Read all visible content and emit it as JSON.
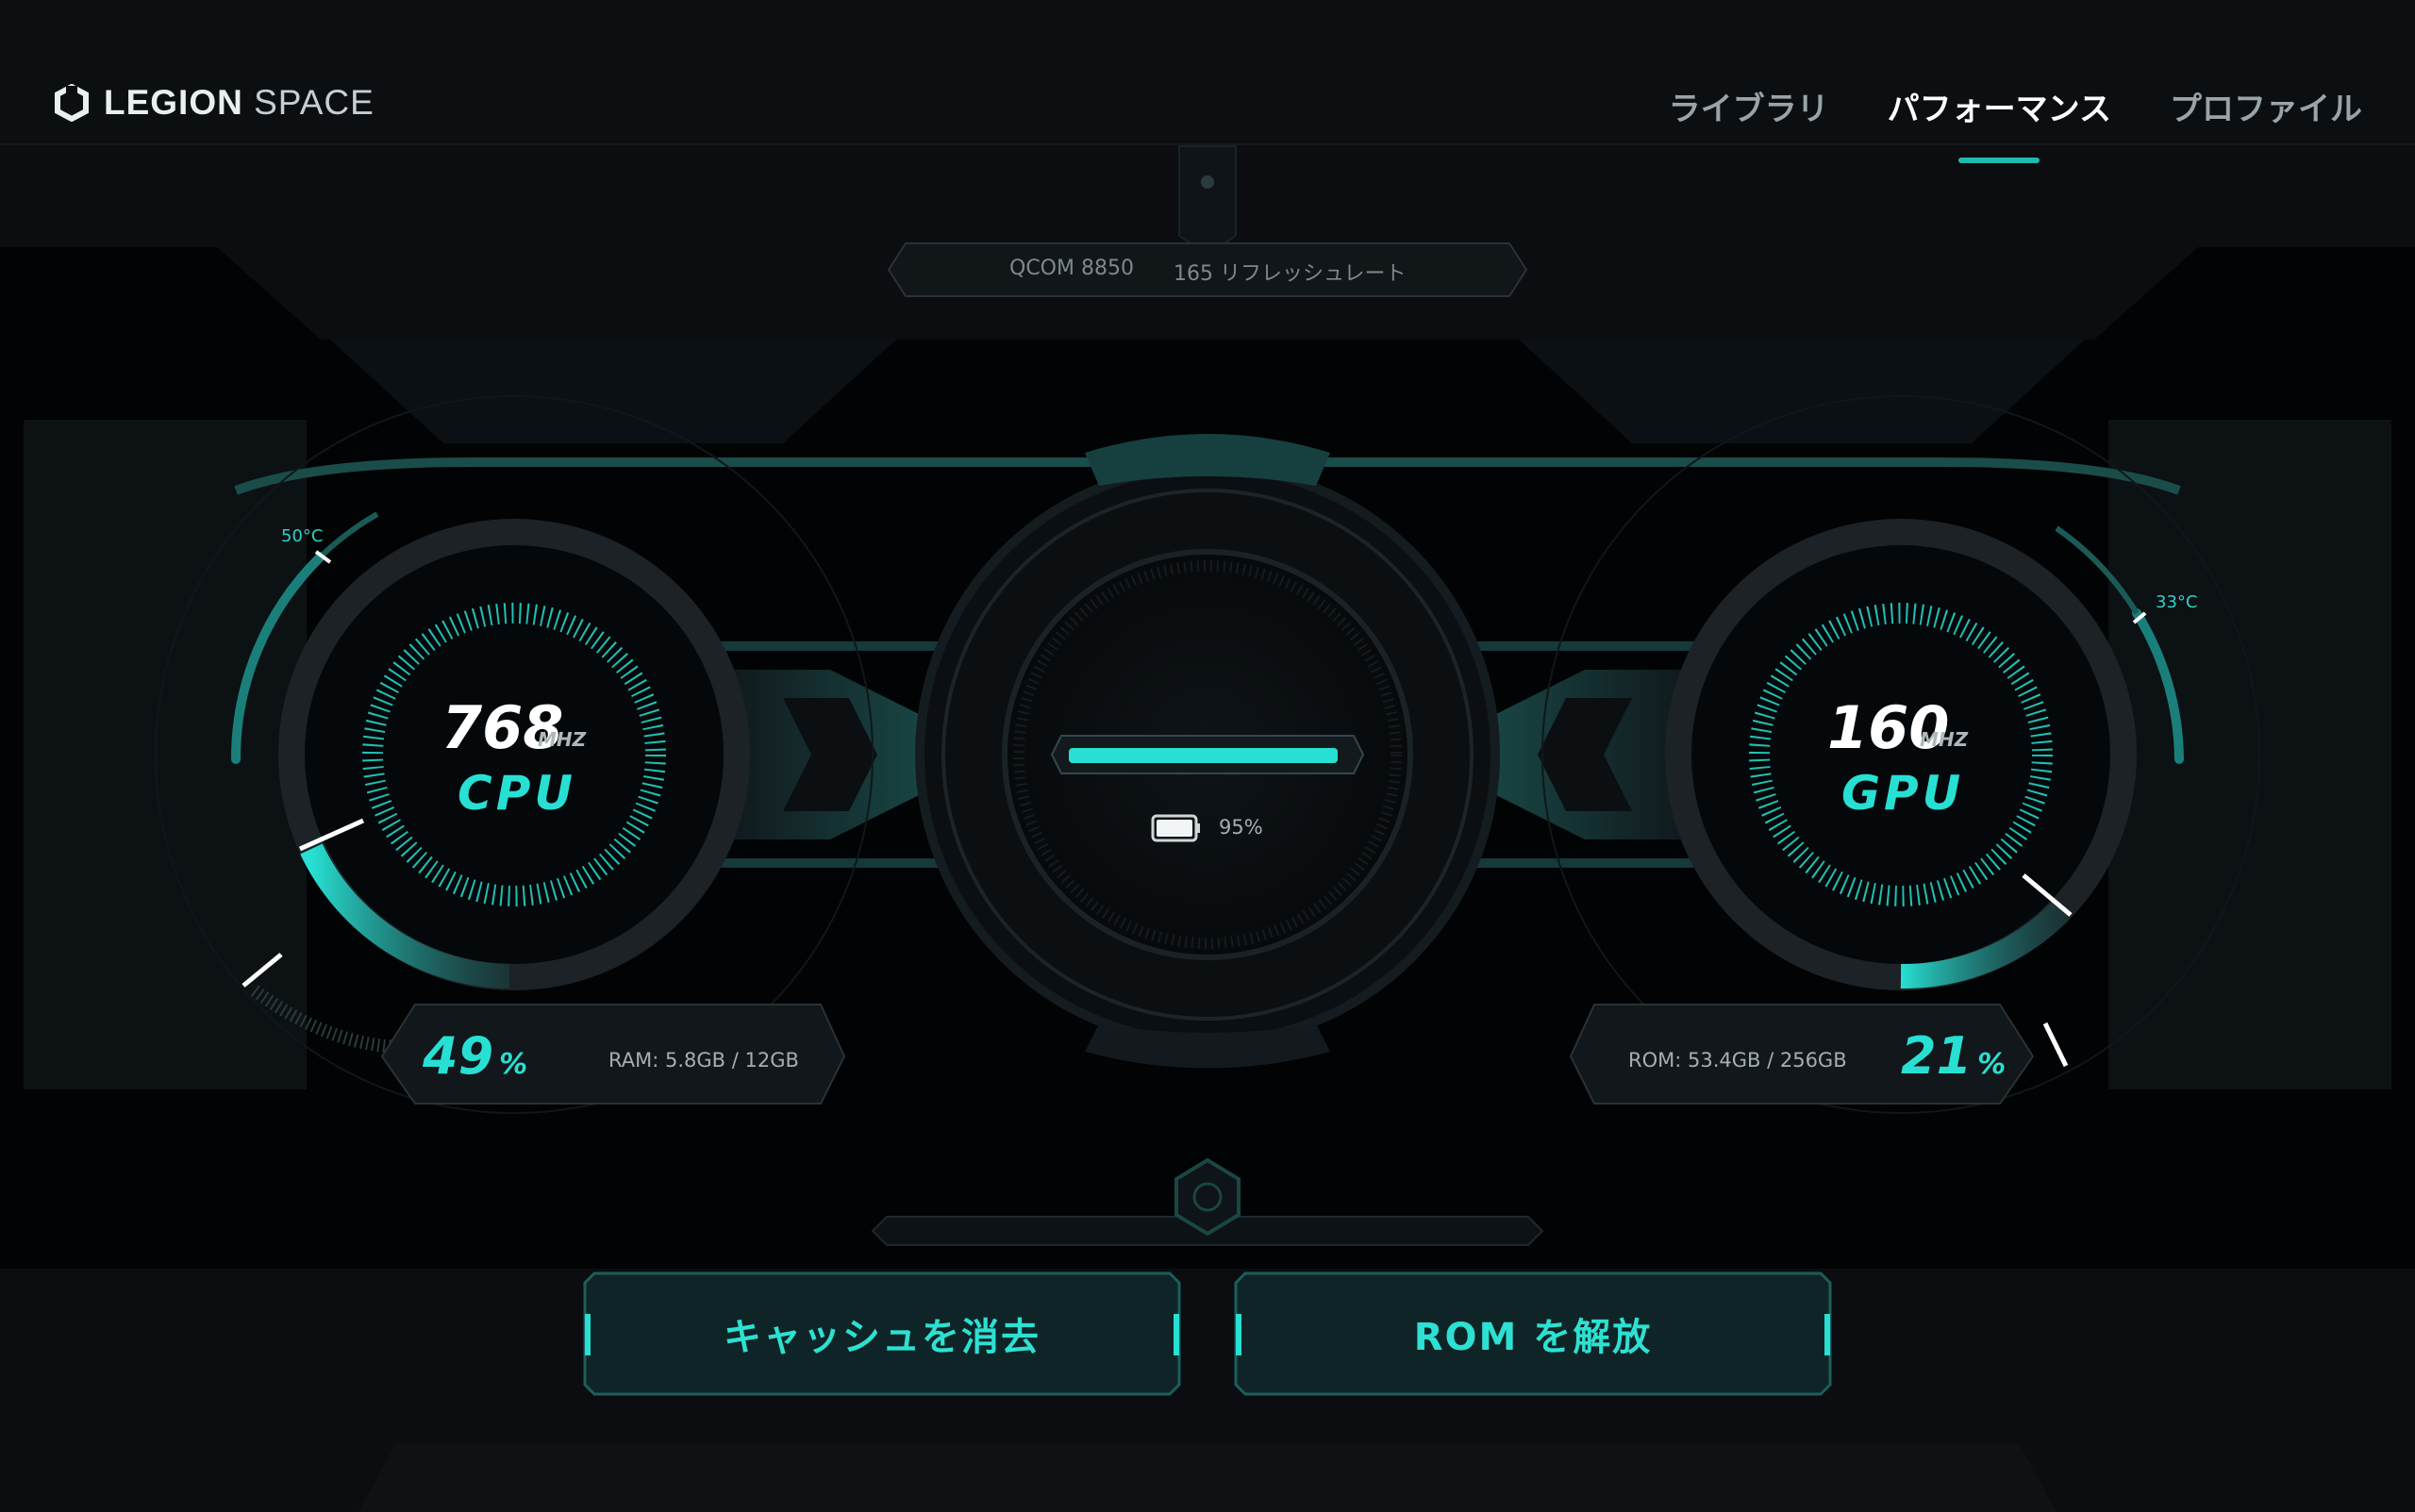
{
  "app": {
    "logo_bold": "LEGION",
    "logo_light": "SPACE"
  },
  "nav": {
    "items": [
      "ライブラリ",
      "パフォーマンス",
      "プロファイル"
    ],
    "active": "パフォーマンス"
  },
  "device": {
    "chip": "QCOM 8850",
    "refresh": "165 リフレッシュレート"
  },
  "cpu": {
    "freq": "768",
    "unit": "MHZ",
    "label": "CPU",
    "temp": "50°C",
    "usage": "49",
    "usage_unit": "%",
    "memory": "RAM: 5.8GB / 12GB"
  },
  "gpu": {
    "freq": "160",
    "unit": "MHZ",
    "label": "GPU",
    "temp": "33°C",
    "usage": "21",
    "usage_unit": "%",
    "storage": "ROM: 53.4GB / 256GB"
  },
  "battery": {
    "level": "95%",
    "fraction": 0.95
  },
  "actions": {
    "clear_cache": "キャッシュを消去",
    "free_rom": "ROM を解放"
  },
  "colors": {
    "accent": "#27e0d3",
    "accent_dark": "#1a8f8a",
    "background": "#0b0d10"
  }
}
